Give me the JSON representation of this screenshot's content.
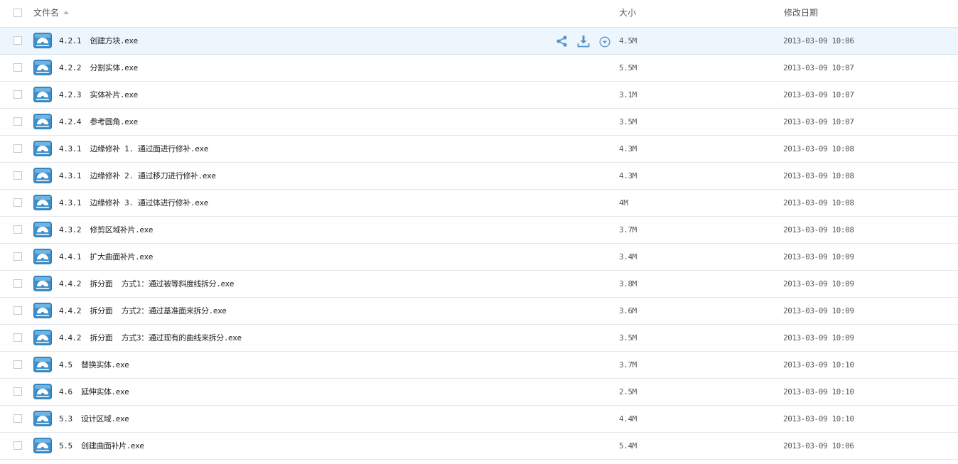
{
  "header": {
    "name_label": "文件名",
    "size_label": "大小",
    "date_label": "修改日期"
  },
  "colors": {
    "hover_row": "#eef6fd",
    "icon_blue": "#3d8fcb",
    "action_icon": "#5a93c4"
  },
  "hover_actions": [
    "share-icon",
    "download-icon",
    "more-icon"
  ],
  "files": [
    {
      "name": "4.2.1  创建方块.exe",
      "size": "4.5M",
      "date": "2013-03-09 10:06"
    },
    {
      "name": "4.2.2  分割实体.exe",
      "size": "5.5M",
      "date": "2013-03-09 10:07"
    },
    {
      "name": "4.2.3  实体补片.exe",
      "size": "3.1M",
      "date": "2013-03-09 10:07"
    },
    {
      "name": "4.2.4  参考圆角.exe",
      "size": "3.5M",
      "date": "2013-03-09 10:07"
    },
    {
      "name": "4.3.1  边缘修补 1. 通过面进行修补.exe",
      "size": "4.3M",
      "date": "2013-03-09 10:08"
    },
    {
      "name": "4.3.1  边缘修补 2. 通过移刀进行修补.exe",
      "size": "4.3M",
      "date": "2013-03-09 10:08"
    },
    {
      "name": "4.3.1  边缘修补 3. 通过体进行修补.exe",
      "size": "4M",
      "date": "2013-03-09 10:08"
    },
    {
      "name": "4.3.2  修剪区域补片.exe",
      "size": "3.7M",
      "date": "2013-03-09 10:08"
    },
    {
      "name": "4.4.1  扩大曲面补片.exe",
      "size": "3.4M",
      "date": "2013-03-09 10:09"
    },
    {
      "name": "4.4.2  拆分面  方式1：通过被等斜度线拆分.exe",
      "size": "3.8M",
      "date": "2013-03-09 10:09"
    },
    {
      "name": "4.4.2  拆分面  方式2：通过基准面来拆分.exe",
      "size": "3.6M",
      "date": "2013-03-09 10:09"
    },
    {
      "name": "4.4.2  拆分面  方式3：通过现有的曲线来拆分.exe",
      "size": "3.5M",
      "date": "2013-03-09 10:09"
    },
    {
      "name": "4.5  替换实体.exe",
      "size": "3.7M",
      "date": "2013-03-09 10:10"
    },
    {
      "name": "4.6  延伸实体.exe",
      "size": "2.5M",
      "date": "2013-03-09 10:10"
    },
    {
      "name": "5.3  设计区域.exe",
      "size": "4.4M",
      "date": "2013-03-09 10:10"
    },
    {
      "name": "5.5  创建曲面补片.exe",
      "size": "5.4M",
      "date": "2013-03-09 10:06"
    }
  ]
}
